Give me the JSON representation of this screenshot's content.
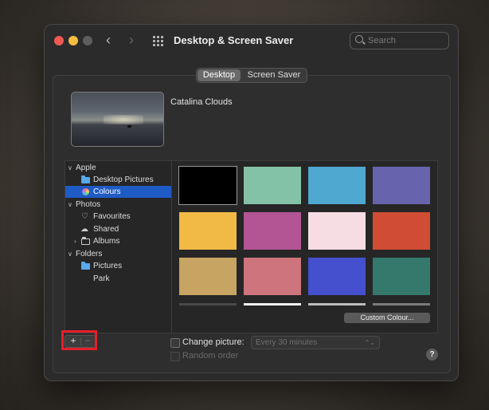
{
  "window": {
    "title": "Desktop & Screen Saver"
  },
  "search": {
    "placeholder": "Search"
  },
  "tabs": [
    {
      "label": "Desktop",
      "active": true
    },
    {
      "label": "Screen Saver",
      "active": false
    }
  ],
  "preview": {
    "name": "Catalina Clouds"
  },
  "sidebar": {
    "groups": [
      {
        "label": "Apple",
        "items": [
          {
            "label": "Desktop Pictures",
            "icon": "folder-icon"
          },
          {
            "label": "Colours",
            "icon": "colours-icon",
            "selected": true
          }
        ]
      },
      {
        "label": "Photos",
        "items": [
          {
            "label": "Favourites",
            "icon": "heart-icon"
          },
          {
            "label": "Shared",
            "icon": "cloud-icon"
          },
          {
            "label": "Albums",
            "icon": "folder-outline-icon"
          }
        ]
      },
      {
        "label": "Folders",
        "items": [
          {
            "label": "Pictures",
            "icon": "folder-icon"
          },
          {
            "label": "Park",
            "icon": ""
          }
        ]
      }
    ]
  },
  "swatches": [
    "#000000",
    "#84c2a7",
    "#4ea8d0",
    "#6764ad",
    "#f0ba45",
    "#b35595",
    "#f5dde3",
    "#d14c34",
    "#c7a462",
    "#cd747c",
    "#4450ce",
    "#35786c"
  ],
  "swatch_peek": [
    "#4a4a4a",
    "#f2f2f2",
    "#bdbdbd",
    "#7a7a7a"
  ],
  "custom_colour": {
    "label": "Custom Colour..."
  },
  "buttons": {
    "add": "+",
    "remove": "−"
  },
  "options": {
    "change_picture": {
      "label": "Change picture:",
      "checked": false
    },
    "interval": {
      "value": "Every 30 minutes"
    },
    "random_order": {
      "label": "Random order",
      "checked": false
    }
  },
  "help": {
    "label": "?"
  },
  "colors": {
    "accent": "#1f5bc5",
    "highlight": "#e3202a"
  }
}
